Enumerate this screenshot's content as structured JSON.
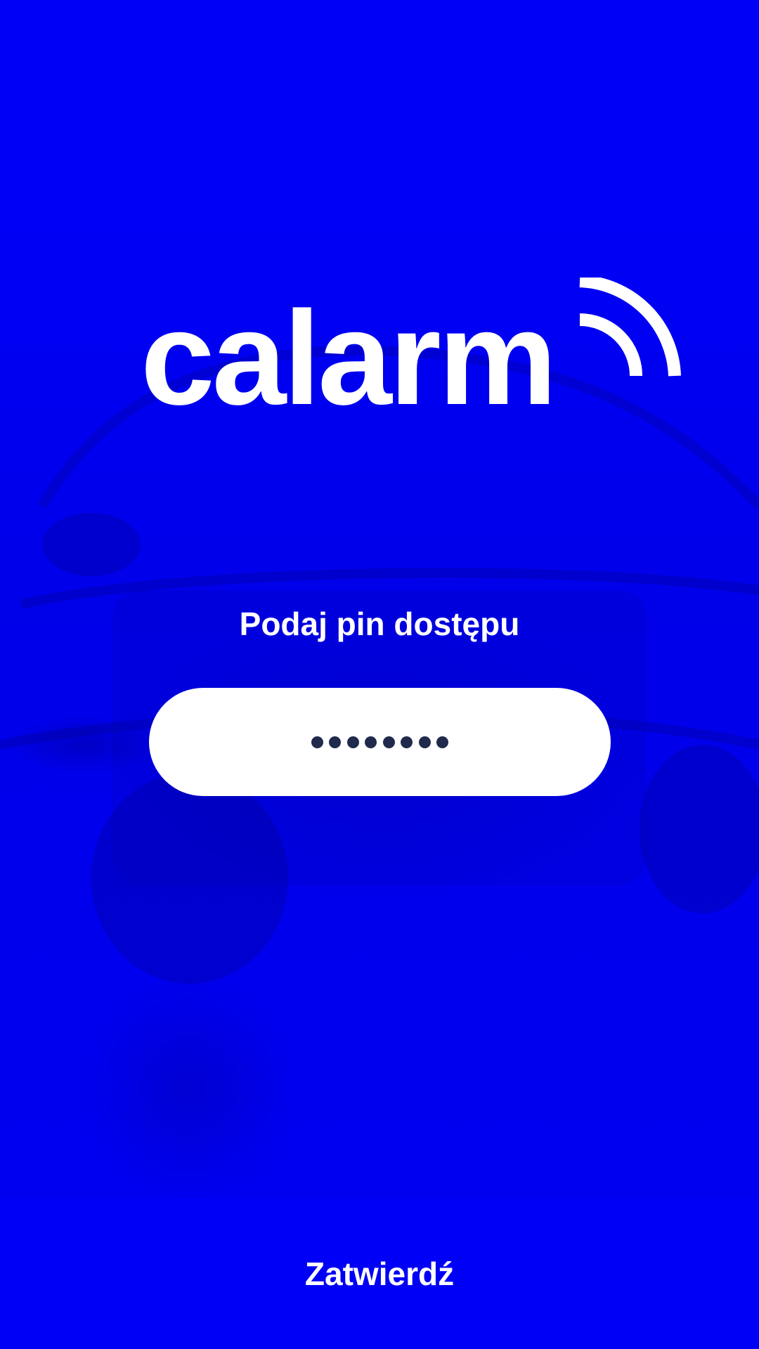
{
  "colors": {
    "background": "#0000f6",
    "text": "#ffffff",
    "field_background": "#ffffff",
    "pin_dot": "#1f2a4d"
  },
  "logo": {
    "text": "calarm",
    "icon": "signal-waves-icon"
  },
  "pin": {
    "label": "Podaj pin dostępu",
    "masked_value": "••••••••",
    "digit_count": 8
  },
  "footer": {
    "confirm_label": "Zatwierdź"
  }
}
